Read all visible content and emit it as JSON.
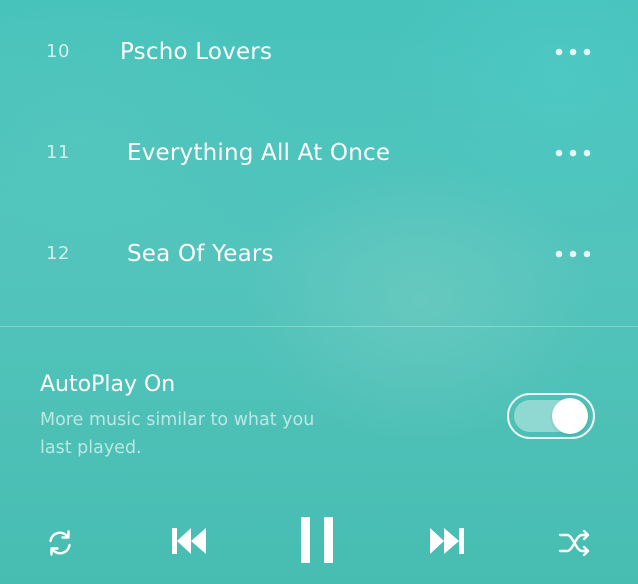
{
  "tracks": [
    {
      "number": "10",
      "title": "Pscho Lovers"
    },
    {
      "number": "11",
      "title": "Everything All At Once"
    },
    {
      "number": "12",
      "title": "Sea Of Years"
    }
  ],
  "more_icon": "ellipsis-horizontal",
  "autoplay": {
    "title": "AutoPlay On",
    "description": "More music similar to what you last played.",
    "enabled": true
  },
  "controls": {
    "repeat_icon": "repeat-icon",
    "previous_icon": "skip-previous-icon",
    "play_pause_icon": "pause-icon",
    "next_icon": "skip-next-icon",
    "shuffle_icon": "shuffle-icon"
  },
  "colors": {
    "background": "#4cc5bd",
    "text": "#ffffff"
  }
}
